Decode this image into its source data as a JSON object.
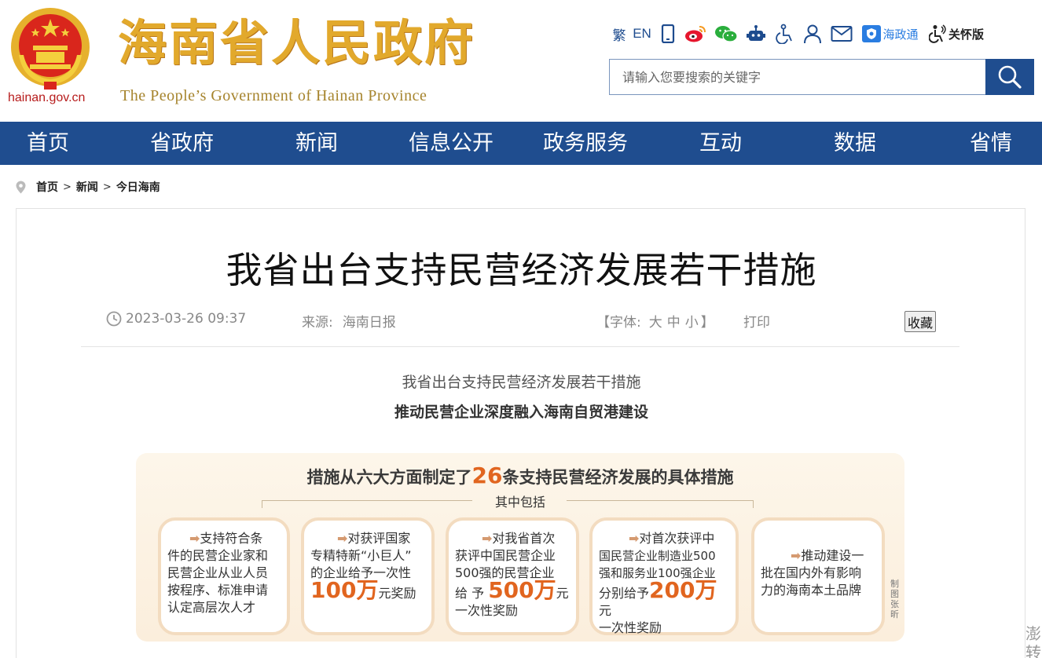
{
  "header": {
    "domain": "hainan.gov.cn",
    "title": "海南省人民政府",
    "subtitle": "The People’s Government  of Hainan Province",
    "toolbar": {
      "traditional": "繁",
      "english": "EN",
      "haizhengtong": "海政通",
      "care_mode": "关怀版",
      "icons": [
        "mobile-icon",
        "weibo-icon",
        "wechat-icon",
        "robot-icon",
        "accessibility-icon",
        "user-icon",
        "mail-icon",
        "haizhengtong-icon",
        "care-mode-icon"
      ]
    },
    "search": {
      "placeholder": "请输入您要搜索的关键字"
    }
  },
  "nav": [
    "首页",
    "省政府",
    "新闻",
    "信息公开",
    "政务服务",
    "互动",
    "数据",
    "省情"
  ],
  "breadcrumb": [
    "首页",
    "新闻",
    "今日海南"
  ],
  "article": {
    "title": "我省出台支持民营经济发展若干措施",
    "date": "2023-03-26 09:37",
    "source_label": "来源:",
    "source": "海南日报",
    "font_label": "【字体:",
    "font_large": "大",
    "font_medium": "中",
    "font_small": "小",
    "font_close": "】",
    "print": "打印",
    "favorite": "收藏",
    "lead_title": "我省出台支持民营经济发展若干措施",
    "lead_subtitle": "推动民营企业深度融入海南自贸港建设"
  },
  "infographic": {
    "headline_pre": "措施从六大方面制定了",
    "headline_num": "26",
    "headline_post": "条支持民营经济发展的具体措施",
    "sub": "其中包括",
    "cards": [
      {
        "lines": [
          "支持符合条",
          "件的民营企业家和",
          "民营企业从业人员",
          "按程序、标准申请",
          "认定高层次人才"
        ]
      },
      {
        "lines": [
          "对获评国家",
          "专精特新“小巨人”",
          "的企业给予一次性"
        ],
        "num": "100万",
        "post": "元奖励"
      },
      {
        "lines": [
          "对我省首次",
          "获评中国民营企业",
          "500强的民营企业"
        ],
        "pre": "给  予",
        "num": "500万",
        "post": "元",
        "tail": "一次性奖励"
      },
      {
        "lines": [
          "对首次获评中",
          "国民营企业制造业500",
          "强和服务业100强企业"
        ],
        "pre": "分别给予",
        "num": "200万",
        "post": "元",
        "tail": "一次性奖励"
      },
      {
        "lines": [
          "推动建设一",
          "批在国内外有影响",
          "力的海南本土品牌"
        ]
      }
    ],
    "credit": "制图 张昕"
  },
  "overflow": "澎\n转"
}
